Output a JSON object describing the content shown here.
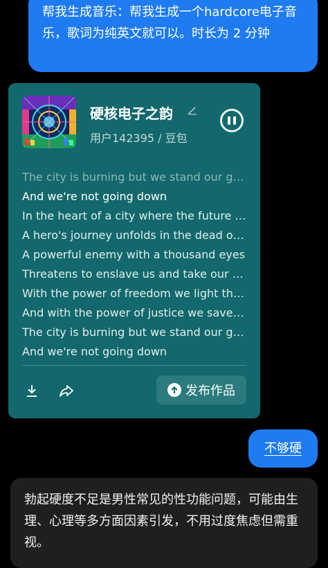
{
  "chat": {
    "user_message_1": "帮我生成音乐：帮我生成一个hardcore电子音乐，歌词为纯英文就可以。时长为 2 分钟",
    "user_message_2": "不够硬",
    "ai_reply": "勃起硬度不足是男性常见的性功能问题，可能由生理、心理等多方面因素引发，不用过度焦虑但需重视。"
  },
  "music_card": {
    "title": "硬核电子之韵",
    "subtitle": "用户142395 / 豆包",
    "lyrics": [
      "The city is burning but we stand our ground",
      "And we're not going down",
      "In the heart of a city where the future lies",
      "A hero's journey unfolds in the dead of night",
      "A powerful enemy with a thousand eyes",
      "Threatens to enslave us and take our lives",
      "With the power of freedom we light the sky",
      "And with the power of justice we save the day",
      "The city is burning but we stand our ground",
      "And we're not going down"
    ],
    "publish_label": "发布作品"
  }
}
